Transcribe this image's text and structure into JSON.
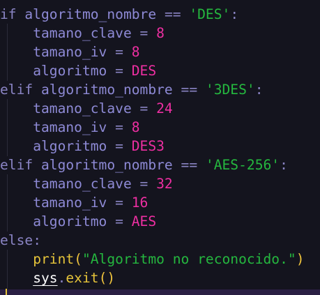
{
  "editor": {
    "lines": [
      {
        "tokens": [
          {
            "t": "if ",
            "c": "kw"
          },
          {
            "t": "algoritmo_nombre ",
            "c": "id"
          },
          {
            "t": "== ",
            "c": "op"
          },
          {
            "t": "'DES'",
            "c": "str"
          },
          {
            "t": ":",
            "c": "op"
          }
        ]
      },
      {
        "tokens": [
          {
            "t": "    ",
            "c": "id"
          },
          {
            "t": "tamano_clave ",
            "c": "id"
          },
          {
            "t": "= ",
            "c": "op"
          },
          {
            "t": "8",
            "c": "num"
          }
        ]
      },
      {
        "tokens": [
          {
            "t": "    ",
            "c": "id"
          },
          {
            "t": "tamano_iv ",
            "c": "id"
          },
          {
            "t": "= ",
            "c": "op"
          },
          {
            "t": "8",
            "c": "num"
          }
        ]
      },
      {
        "tokens": [
          {
            "t": "    ",
            "c": "id"
          },
          {
            "t": "algoritmo ",
            "c": "id"
          },
          {
            "t": "= ",
            "c": "op"
          },
          {
            "t": "DES",
            "c": "val"
          }
        ]
      },
      {
        "tokens": [
          {
            "t": "elif ",
            "c": "kw"
          },
          {
            "t": "algoritmo_nombre ",
            "c": "id"
          },
          {
            "t": "== ",
            "c": "op"
          },
          {
            "t": "'3DES'",
            "c": "str"
          },
          {
            "t": ":",
            "c": "op"
          }
        ]
      },
      {
        "tokens": [
          {
            "t": "    ",
            "c": "id"
          },
          {
            "t": "tamano_clave ",
            "c": "id"
          },
          {
            "t": "= ",
            "c": "op"
          },
          {
            "t": "24",
            "c": "num"
          }
        ]
      },
      {
        "tokens": [
          {
            "t": "    ",
            "c": "id"
          },
          {
            "t": "tamano_iv ",
            "c": "id"
          },
          {
            "t": "= ",
            "c": "op"
          },
          {
            "t": "8",
            "c": "num"
          }
        ]
      },
      {
        "tokens": [
          {
            "t": "    ",
            "c": "id"
          },
          {
            "t": "algoritmo ",
            "c": "id"
          },
          {
            "t": "= ",
            "c": "op"
          },
          {
            "t": "DES3",
            "c": "val"
          }
        ]
      },
      {
        "tokens": [
          {
            "t": "elif ",
            "c": "kw"
          },
          {
            "t": "algoritmo_nombre ",
            "c": "id"
          },
          {
            "t": "== ",
            "c": "op"
          },
          {
            "t": "'AES-256'",
            "c": "str"
          },
          {
            "t": ":",
            "c": "op"
          }
        ]
      },
      {
        "tokens": [
          {
            "t": "    ",
            "c": "id"
          },
          {
            "t": "tamano_clave ",
            "c": "id"
          },
          {
            "t": "= ",
            "c": "op"
          },
          {
            "t": "32",
            "c": "num"
          }
        ]
      },
      {
        "tokens": [
          {
            "t": "    ",
            "c": "id"
          },
          {
            "t": "tamano_iv ",
            "c": "id"
          },
          {
            "t": "= ",
            "c": "op"
          },
          {
            "t": "16",
            "c": "num"
          }
        ]
      },
      {
        "tokens": [
          {
            "t": "    ",
            "c": "id"
          },
          {
            "t": "algoritmo ",
            "c": "id"
          },
          {
            "t": "= ",
            "c": "op"
          },
          {
            "t": "AES",
            "c": "val"
          }
        ]
      },
      {
        "tokens": [
          {
            "t": "else",
            "c": "kw"
          },
          {
            "t": ":",
            "c": "op"
          }
        ]
      },
      {
        "tokens": [
          {
            "t": "    ",
            "c": "id"
          },
          {
            "t": "print",
            "c": "fn"
          },
          {
            "t": "(",
            "c": "paren"
          },
          {
            "t": "\"Algoritmo no reconocido.\"",
            "c": "str"
          },
          {
            "t": ")",
            "c": "paren"
          }
        ]
      },
      {
        "tokens": [
          {
            "t": "    ",
            "c": "id"
          },
          {
            "t": "sys",
            "c": "mod"
          },
          {
            "t": ".",
            "c": "op"
          },
          {
            "t": "exit",
            "c": "fn"
          },
          {
            "t": "()",
            "c": "paren"
          }
        ]
      }
    ]
  }
}
